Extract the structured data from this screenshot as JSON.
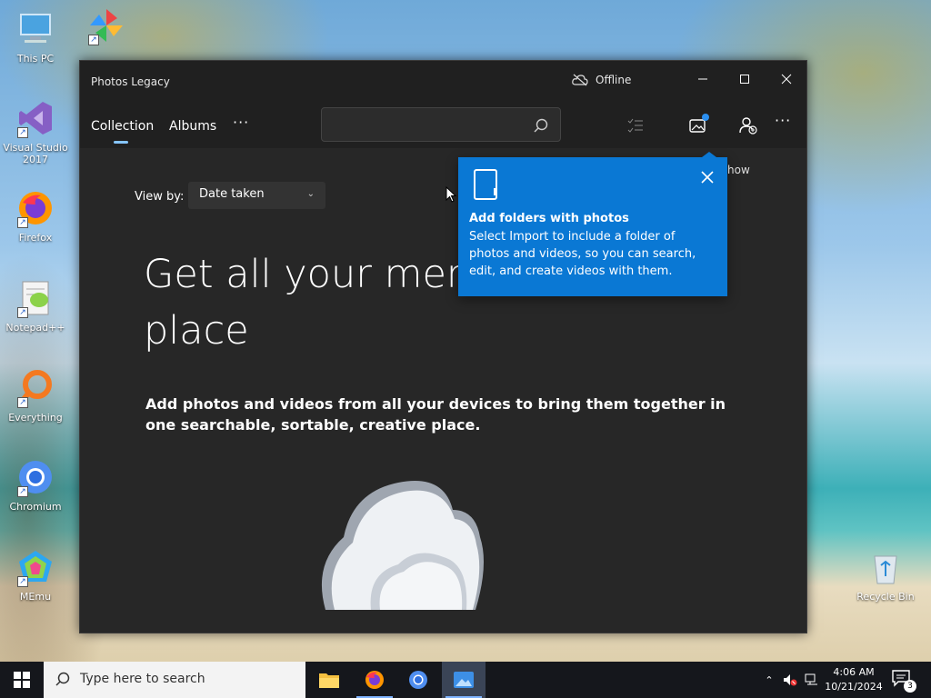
{
  "desktop": {
    "icons": [
      {
        "label": "This PC",
        "icon": "computer-icon"
      },
      {
        "label": "Visual Studio 2017",
        "icon": "visual-studio-icon"
      },
      {
        "label": "Firefox",
        "icon": "firefox-icon"
      },
      {
        "label": "Notepad++",
        "icon": "notepadpp-icon"
      },
      {
        "label": "Everything",
        "icon": "everything-icon"
      },
      {
        "label": "Chromium",
        "icon": "chromium-icon"
      },
      {
        "label": "MEmu",
        "icon": "memu-icon"
      }
    ],
    "recycle_bin": {
      "label": "Recycle Bin",
      "icon": "recycle-bin-icon"
    }
  },
  "window": {
    "title": "Photos Legacy",
    "status": "Offline",
    "tabs": [
      {
        "label": "Collection",
        "selected": true
      },
      {
        "label": "Albums",
        "selected": false
      }
    ],
    "more_label": "···",
    "search": {
      "placeholder": ""
    },
    "toolbar_more": "···"
  },
  "content": {
    "view_by_label": "View by:",
    "view_by_value": "Date taken",
    "headline": "Get all your memo\nplace",
    "subline": "Add photos and videos from all your devices to bring them together in one searchable, sortable, creative place."
  },
  "tip": {
    "title": "Add folders with photos",
    "body": "Select Import to include a folder of photos and videos, so you can search, edit, and create videos with them.",
    "behind_text": "how"
  },
  "taskbar": {
    "search_placeholder": "Type here to search",
    "time": "4:06 AM",
    "date": "10/21/2024",
    "notification_count": "3"
  },
  "colors": {
    "accent": "#0a78d4",
    "window_bg": "#272727",
    "tab_underline": "#86c5ff"
  }
}
